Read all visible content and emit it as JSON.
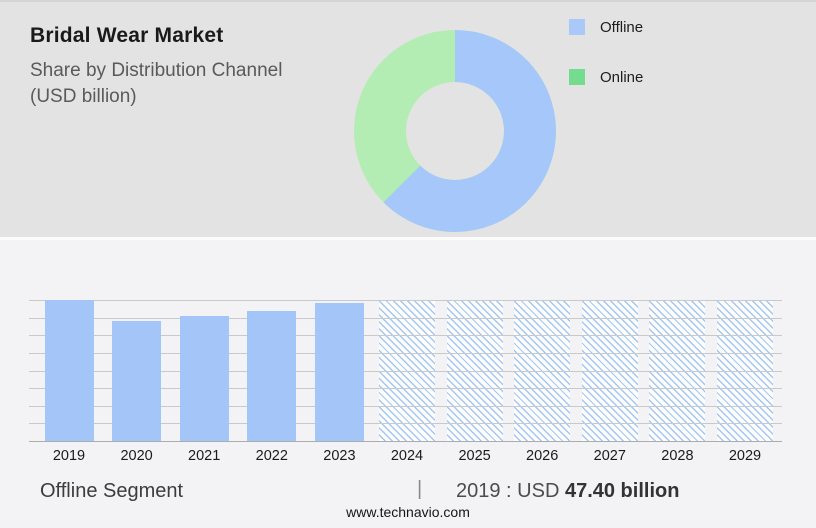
{
  "header": {
    "title": "Bridal Wear Market",
    "subtitle": "Share by Distribution Channel (USD billion)"
  },
  "legend": {
    "items": [
      {
        "label": "Offline",
        "color": "#a9c9f9"
      },
      {
        "label": "Online",
        "color": "#74dc8f"
      }
    ]
  },
  "chart_data": [
    {
      "type": "pie",
      "variant": "donut",
      "title": "Share by Distribution Channel (USD billion)",
      "start_angle_deg": 0,
      "direction": "clockwise",
      "inner_radius_pct": 48,
      "segments": [
        {
          "label": "Offline",
          "value_pct": 62.5,
          "color": "#a6c7f9"
        },
        {
          "label": "Online",
          "value_pct": 37.5,
          "color": "#b4edb4"
        }
      ],
      "legend_position": "right"
    },
    {
      "type": "bar",
      "title": "Offline Segment market size by year",
      "categories": [
        "2019",
        "2020",
        "2021",
        "2022",
        "2023",
        "2024",
        "2025",
        "2026",
        "2027",
        "2028",
        "2029"
      ],
      "heights_pct_of_plot": [
        100,
        85.2,
        88.8,
        92.4,
        97.6,
        100,
        100,
        100,
        100,
        100,
        100
      ],
      "bar_styles": [
        "solid",
        "solid",
        "solid",
        "solid",
        "solid",
        "hatched",
        "hatched",
        "hatched",
        "hatched",
        "hatched",
        "hatched"
      ],
      "hatched_meaning": "forecast placeholder (full height)",
      "known_value": {
        "year": "2019",
        "value_usd_billion": 47.4
      },
      "estimated_values_usd_billion": {
        "2019": 47.4,
        "2020": 40.4,
        "2021": 42.1,
        "2022": 43.8,
        "2023": 46.3
      },
      "solid_color": "#a4c5f8",
      "hatch_line_color": "#a3c6f4",
      "gridlines": 9,
      "grid_on": true,
      "xlabel": "",
      "ylabel": ""
    }
  ],
  "footer": {
    "segment_label": "Offline Segment",
    "separator": "|",
    "stat_prefix": "2019 : USD ",
    "stat_value": "47.40 billion",
    "website": "www.technavio.com"
  }
}
